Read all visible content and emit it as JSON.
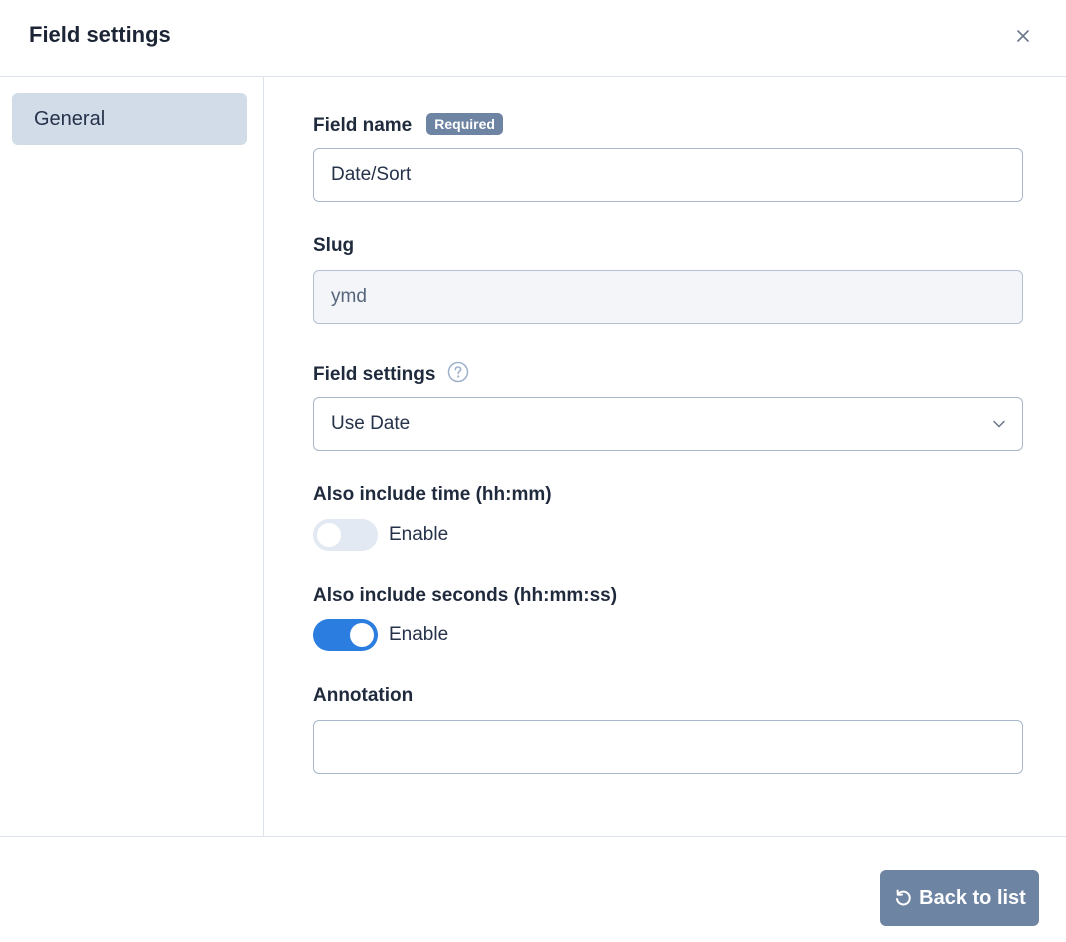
{
  "header": {
    "title": "Field settings"
  },
  "sidebar": {
    "items": [
      {
        "label": "General"
      }
    ]
  },
  "form": {
    "field_name": {
      "label": "Field name",
      "badge": "Required",
      "value": "Date/Sort"
    },
    "slug": {
      "label": "Slug",
      "value": "ymd"
    },
    "field_settings": {
      "label": "Field settings",
      "selected": "Use Date"
    },
    "include_time": {
      "label": "Also include time (hh:mm)",
      "toggle_label": "Enable",
      "enabled": false
    },
    "include_seconds": {
      "label": "Also include seconds (hh:mm:ss)",
      "toggle_label": "Enable",
      "enabled": true
    },
    "annotation": {
      "label": "Annotation",
      "value": ""
    }
  },
  "footer": {
    "back_label": "Back to list"
  },
  "colors": {
    "accent": "#2b7de0",
    "badge": "#6e84a3",
    "button": "#6e84a3",
    "sidebar_active": "#d1dce8"
  }
}
